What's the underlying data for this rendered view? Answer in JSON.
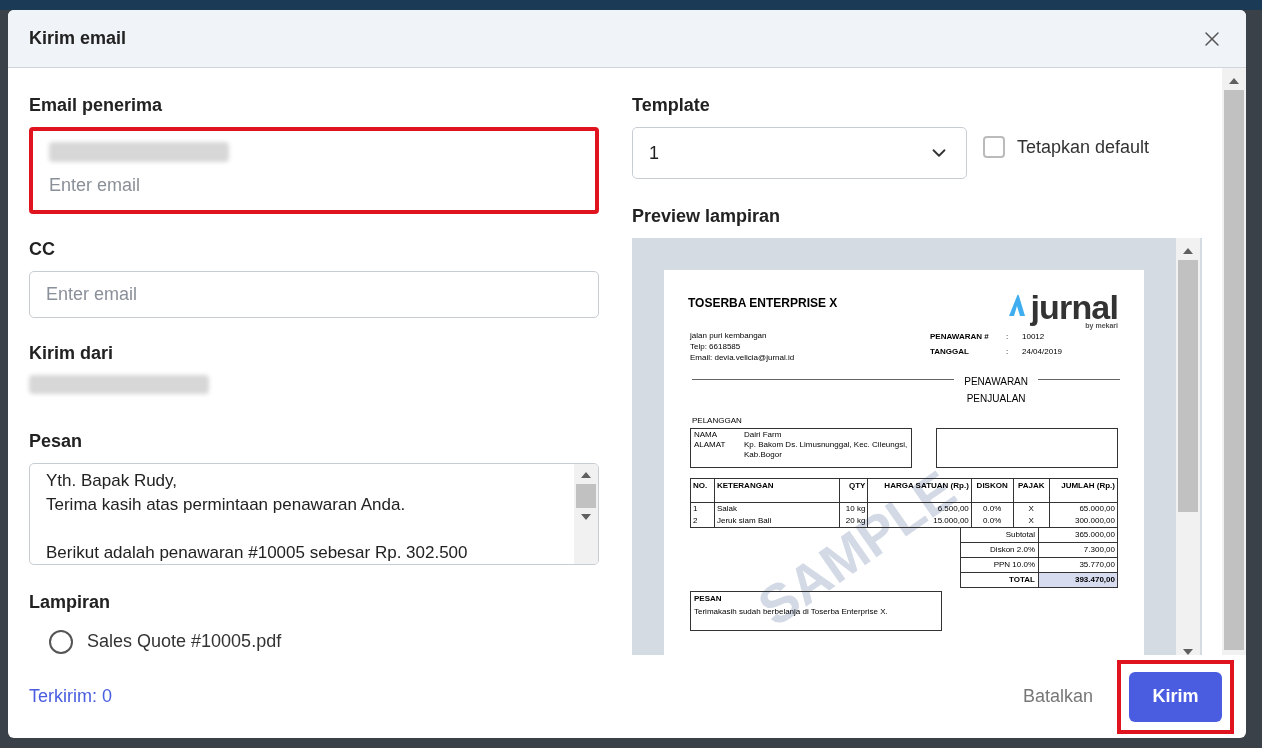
{
  "dialog": {
    "title": "Kirim email"
  },
  "recipient": {
    "label": "Email penerima",
    "placeholder": "Enter email",
    "highlighted": true
  },
  "cc": {
    "label": "CC",
    "placeholder": "Enter email"
  },
  "sender": {
    "label": "Kirim dari"
  },
  "message": {
    "label": "Pesan",
    "value": "Yth. Bapak Rudy,\nTerima kasih atas permintaan penawaran Anda.\n\nBerikut adalah penawaran #10005 sebesar Rp. 302.500"
  },
  "attachments": {
    "label": "Lampiran",
    "items": [
      {
        "name": "Sales Quote #10005.pdf",
        "checked": false
      }
    ]
  },
  "template": {
    "label": "Template",
    "value": "1"
  },
  "default_checkbox": {
    "label": "Tetapkan default",
    "checked": false
  },
  "preview": {
    "label": "Preview lampiran",
    "document": {
      "company": "TOSERBA ENTERPRISE X",
      "logo": "jurnal",
      "logo_sub": "by mekari",
      "address": [
        "jalan puri kembangan",
        "Telp: 6618585",
        "Email: devia.velicia@jurnal.id"
      ],
      "meta": [
        {
          "label": "PENAWARAN #",
          "separator": ":",
          "value": "10012"
        },
        {
          "label": "TANGGAL",
          "separator": ":",
          "value": "24/04/2019"
        }
      ],
      "title": [
        "PENAWARAN",
        "PENJUALAN"
      ],
      "customer_heading": "PELANGGAN",
      "customer": [
        {
          "label": "NAMA",
          "value": "Dairi Farm"
        },
        {
          "label": "ALAMAT",
          "value": "Kp. Bakom Ds. Limusnunggal, Kec. Cileungsi, Kab.Bogor"
        }
      ],
      "columns": [
        "NO.",
        "KETERANGAN",
        "QTY",
        "HARGA SATUAN (Rp.)",
        "DISKON",
        "PAJAK",
        "JUMLAH (Rp.)"
      ],
      "rows": [
        [
          "1",
          "Salak",
          "10 kg",
          "6.500,00",
          "0.0%",
          "X",
          "65.000,00"
        ],
        [
          "2",
          "Jeruk siam Bali",
          "20 kg",
          "15.000,00",
          "0.0%",
          "X",
          "300.000,00"
        ]
      ],
      "totals": [
        {
          "label": "Subtotal",
          "value": "365.000,00",
          "highlighted": false
        },
        {
          "label": "Diskon 2.0%",
          "value": "7.300,00",
          "highlighted": false
        },
        {
          "label": "PPN 10.0%",
          "value": "35.770,00",
          "highlighted": false
        },
        {
          "label": "TOTAL",
          "value": "393.470,00",
          "highlighted": true
        }
      ],
      "note_heading": "PESAN",
      "note": "Terimakasih sudah berbelanja di Toserba Enterprise X.",
      "watermark": "SAMPLE"
    }
  },
  "footer": {
    "sent_count": "Terkirim: 0",
    "cancel": "Batalkan",
    "send": "Kirim",
    "send_highlighted": true
  }
}
